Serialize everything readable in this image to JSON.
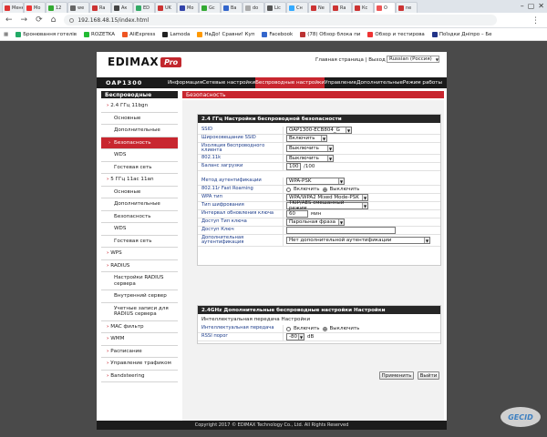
{
  "browser": {
    "tabs": [
      "Меню",
      "Мо",
      "12",
      "we",
      "Ra",
      "Ак",
      "ED",
      "UK",
      "Мо",
      "Gc",
      "Ва",
      "do",
      "Lic",
      "Сн",
      "Ne",
      "Ra",
      "Кс",
      "О",
      "ne"
    ],
    "active_tab_index": 17,
    "url": "192.168.48.15/index.html",
    "bookmarks": [
      "Бронювання готелів",
      "ROZETKA",
      "AliExpress",
      "Lamoda",
      "НаДо! Сравни! Куп",
      "Facebook",
      "(78) Обзор блока пи",
      "Обзор и тестирова",
      "Поїздки Дніпро – Бе"
    ]
  },
  "header": {
    "logo_text": "EDIMAX",
    "logo_badge": "Pro",
    "links": "Главная страница | Выход | Language",
    "language": "Russian (Россия)",
    "model": "OAP1300"
  },
  "topnav": [
    "Информация",
    "Сетевые настройки",
    "Беспроводные настройки",
    "Управление",
    "Дополнительные",
    "Режим работы"
  ],
  "topnav_active": 2,
  "sidebar": {
    "title": "Беспроводные",
    "items": [
      {
        "label": "2.4 ГГц 11bgn",
        "group": true
      },
      {
        "label": "Основные"
      },
      {
        "label": "Дополнительные"
      },
      {
        "label": "Безопасность",
        "active": true
      },
      {
        "label": "WDS"
      },
      {
        "label": "Гостевая сеть"
      },
      {
        "label": "5 ГГц 11ac 11an",
        "group": true
      },
      {
        "label": "Основные"
      },
      {
        "label": "Дополнительные"
      },
      {
        "label": "Безопасность"
      },
      {
        "label": "WDS"
      },
      {
        "label": "Гостевая сеть"
      },
      {
        "label": "WPS",
        "group": true
      },
      {
        "label": "RADIUS",
        "group": true
      },
      {
        "label": "Настройки RADIUS сервера"
      },
      {
        "label": "Внутренний сервер"
      },
      {
        "label": "Учетные записи для RADIUS сервера"
      },
      {
        "label": "MAC фильтр",
        "group": true
      },
      {
        "label": "WMM",
        "group": true
      },
      {
        "label": "Расписание",
        "group": true
      },
      {
        "label": "Управление трафиком",
        "group": true
      },
      {
        "label": "Bandsteering",
        "group": true
      }
    ]
  },
  "main": {
    "title": "Безопасность",
    "section1": {
      "title": "2.4 ГГц Настройки беспроводной безопасности",
      "ssid_label": "SSID",
      "ssid_value": "OAP1300-ECB804_G",
      "broadcast_label": "Широковещание SSID",
      "broadcast_value": "Включить",
      "isolation_label": "Изоляция беспроводного клиента",
      "isolation_value": "Выключить",
      "r80211k_label": "802.11k",
      "r80211k_value": "Выключить",
      "balance_label": "Баланс загрузки",
      "balance_value": "100",
      "balance_unit": "/100",
      "auth_label": "Метод аутентификации",
      "auth_value": "WPA-PSK",
      "roaming_label": "802.11r Fast Roaming",
      "roaming_on": "Включить",
      "roaming_off": "Выключить",
      "wpatype_label": "WPA тип",
      "wpatype_value": "WPA/WPA2 Mixed Mode-PSK",
      "enc_label": "Тип шифрования",
      "enc_value": "TKIP/AES смешанный режим",
      "rekey_label": "Интервал обновления ключа",
      "rekey_value": "60",
      "rekey_unit": "мин",
      "keyaccess_label": "Доступ Тип ключа",
      "keyaccess_value": "Парольная фраза",
      "key_label": "Доступ Ключ",
      "key_value": "",
      "addauth_label": "Дополнительная аутентификация",
      "addauth_value": "Нет дополнительной аутентификации"
    },
    "section2": {
      "title": "2.4GHz Дополнительные беспроводные настройки Настройки",
      "subtitle": "Интеллектуальная передача Настройки",
      "smart_label": "Интеллектуальная передача",
      "smart_on": "Включить",
      "smart_off": "Выключить",
      "rssi_label": "RSSI порог",
      "rssi_value": "-80",
      "rssi_unit": "dB"
    },
    "apply_button": "Применить",
    "exit_button": "Выйти"
  },
  "footer": "Copyright 2017 © EDIMAX Technology Co., Ltd. All Rights Reserved"
}
